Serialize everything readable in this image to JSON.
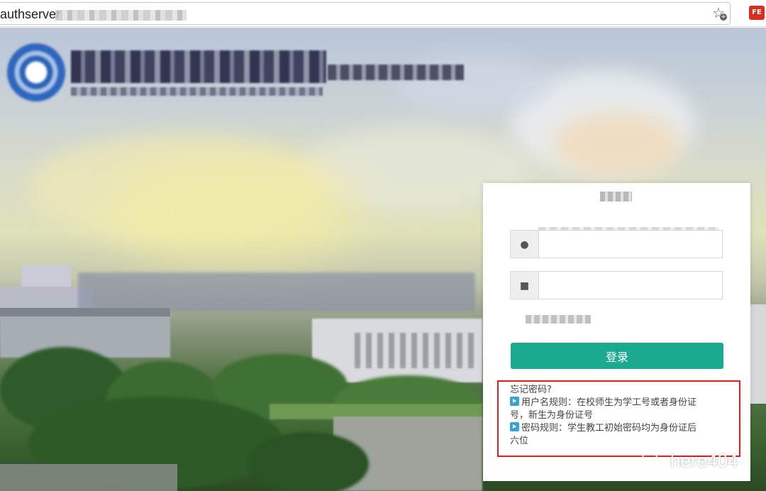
{
  "browser": {
    "url_visible": "authserver",
    "bookmark_icon": "star-add-icon",
    "extension_icon_label": "FE"
  },
  "logo": {
    "emblem_icon": "university-emblem-icon"
  },
  "login": {
    "username_icon": "user-icon",
    "password_icon": "lock-icon",
    "button_label": "登录",
    "button_color": "#1aaa8f"
  },
  "help": {
    "forgot_password": "忘记密码?",
    "username_rule_line1": "用户名规则：在校师生为学工号或者身份证",
    "username_rule_line2": "号，新生为身份证号",
    "password_rule_line1": "密码规则：学生教工初始密码均为身份证后",
    "password_rule_line2": "六位",
    "highlight_color": "#e02020"
  },
  "watermark": {
    "text": "here404",
    "icon": "wechat-icon"
  }
}
